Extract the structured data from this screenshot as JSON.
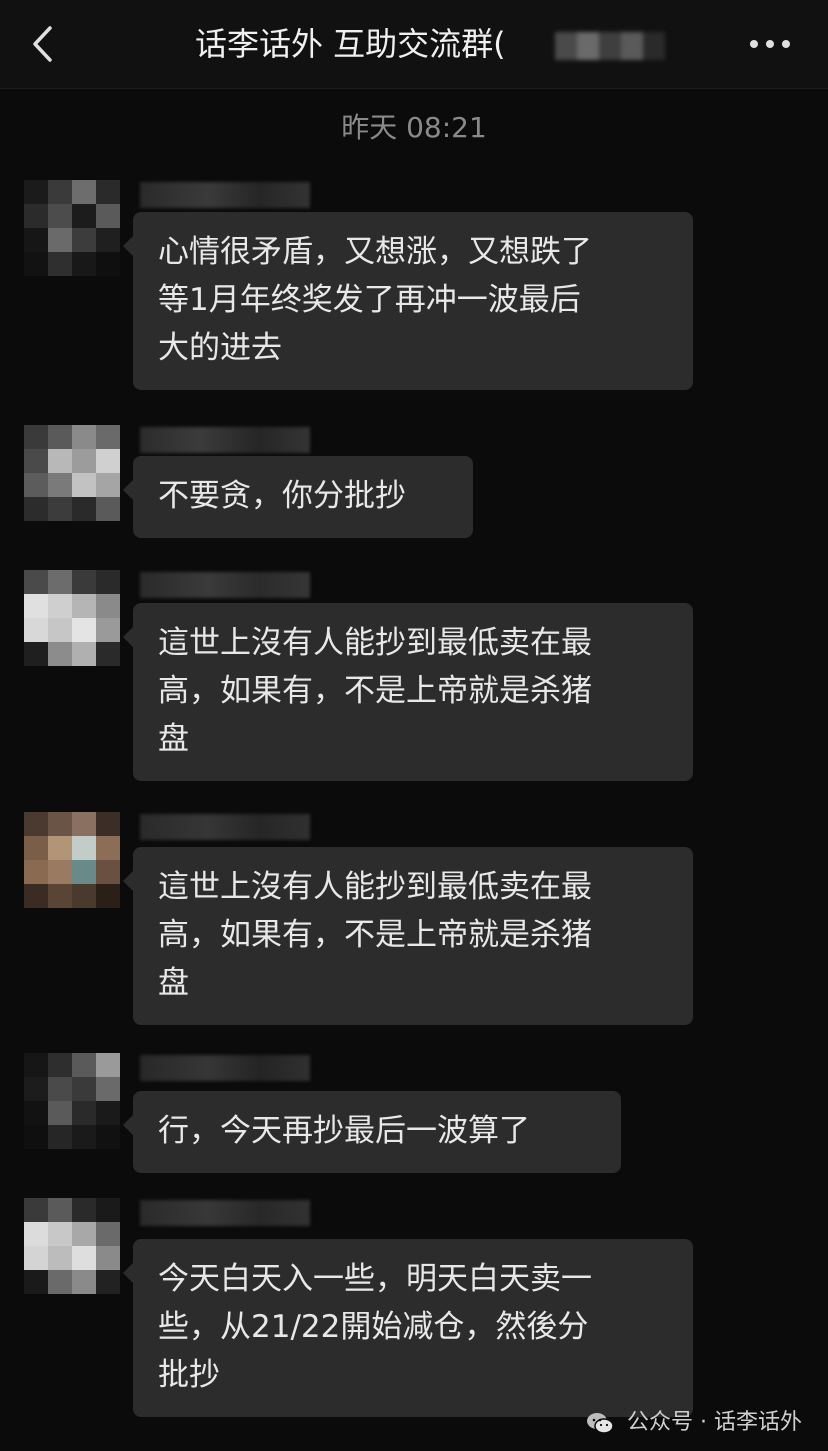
{
  "header": {
    "title": "话李话外 互助交流群(",
    "back_icon": "chevron-left-icon",
    "more_icon": "more-dots-icon"
  },
  "timestamp": "昨天 08:21",
  "messages": [
    {
      "text": "心情很矛盾，又想涨，又想跌了\n等1月年终奖发了再冲一波最后\n大的进去"
    },
    {
      "text": "不要贪，你分批抄"
    },
    {
      "text": "這世上沒有人能抄到最低卖在最\n高，如果有，不是上帝就是杀猪\n盘"
    },
    {
      "text": "這世上沒有人能抄到最低卖在最\n高，如果有，不是上帝就是杀猪\n盘"
    },
    {
      "text": "行，今天再抄最后一波算了"
    },
    {
      "text": "今天白天入一些，明天白天卖一\n些，从21/22開始减仓，然後分\n批抄"
    }
  ],
  "watermark": {
    "label": "公众号 · 话李话外",
    "icon": "wechat-icon"
  }
}
